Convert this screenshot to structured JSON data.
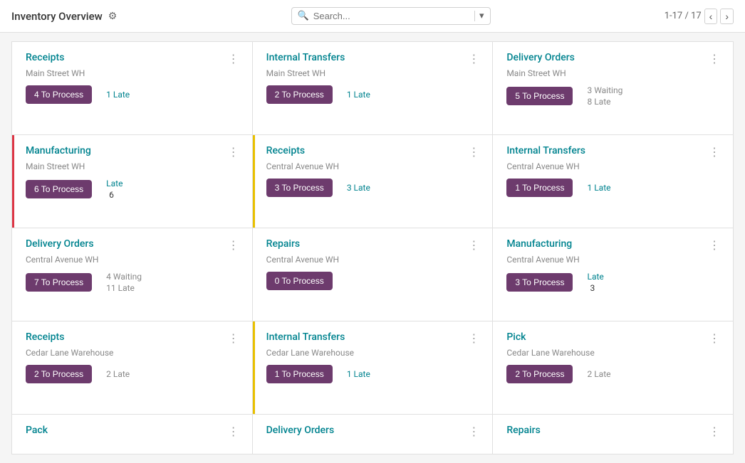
{
  "header": {
    "title": "Inventory Overview",
    "gear_label": "⚙",
    "search_placeholder": "Search...",
    "pagination": "1-17 / 17"
  },
  "cards": [
    {
      "id": "card-1",
      "title": "Receipts",
      "subtitle": "Main Street WH",
      "btn_label": "4 To Process",
      "stats": [
        {
          "label": "1 Late",
          "type": "late"
        }
      ],
      "border": "none"
    },
    {
      "id": "card-2",
      "title": "Internal Transfers",
      "subtitle": "Main Street WH",
      "btn_label": "2 To Process",
      "stats": [
        {
          "label": "1 Late",
          "type": "late"
        }
      ],
      "border": "none"
    },
    {
      "id": "card-3",
      "title": "Delivery Orders",
      "subtitle": "Main Street WH",
      "btn_label": "5 To Process",
      "stats": [
        {
          "label": "3 Waiting",
          "type": "waiting"
        },
        {
          "label": "8 Late",
          "type": "waiting"
        }
      ],
      "border": "none"
    },
    {
      "id": "card-4",
      "title": "Manufacturing",
      "subtitle": "Main Street WH",
      "btn_label": "6 To Process",
      "stats": [
        {
          "label": "Late",
          "type": "late"
        },
        {
          "label": "6",
          "type": "number"
        }
      ],
      "border": "red"
    },
    {
      "id": "card-5",
      "title": "Receipts",
      "subtitle": "Central Avenue WH",
      "btn_label": "3 To Process",
      "stats": [
        {
          "label": "3 Late",
          "type": "late"
        }
      ],
      "border": "yellow"
    },
    {
      "id": "card-6",
      "title": "Internal Transfers",
      "subtitle": "Central Avenue WH",
      "btn_label": "1 To Process",
      "stats": [
        {
          "label": "1 Late",
          "type": "late"
        }
      ],
      "border": "none"
    },
    {
      "id": "card-7",
      "title": "Delivery Orders",
      "subtitle": "Central Avenue WH",
      "btn_label": "7 To Process",
      "stats": [
        {
          "label": "4 Waiting",
          "type": "waiting"
        },
        {
          "label": "11 Late",
          "type": "waiting"
        }
      ],
      "border": "none"
    },
    {
      "id": "card-8",
      "title": "Repairs",
      "subtitle": "Central Avenue WH",
      "btn_label": "0 To Process",
      "stats": [],
      "border": "none"
    },
    {
      "id": "card-9",
      "title": "Manufacturing",
      "subtitle": "Central Avenue WH",
      "btn_label": "3 To Process",
      "stats": [
        {
          "label": "Late",
          "type": "late"
        },
        {
          "label": "3",
          "type": "number"
        }
      ],
      "border": "none"
    },
    {
      "id": "card-10",
      "title": "Receipts",
      "subtitle": "Cedar Lane Warehouse",
      "btn_label": "2 To Process",
      "stats": [
        {
          "label": "2 Late",
          "type": "waiting"
        }
      ],
      "border": "none"
    },
    {
      "id": "card-11",
      "title": "Internal Transfers",
      "subtitle": "Cedar Lane Warehouse",
      "btn_label": "1 To Process",
      "stats": [
        {
          "label": "1 Late",
          "type": "late"
        }
      ],
      "border": "yellow"
    },
    {
      "id": "card-12",
      "title": "Pick",
      "subtitle": "Cedar Lane Warehouse",
      "btn_label": "2 To Process",
      "stats": [
        {
          "label": "2 Late",
          "type": "waiting"
        }
      ],
      "border": "none"
    },
    {
      "id": "card-13",
      "title": "Pack",
      "subtitle": "",
      "btn_label": "",
      "stats": [],
      "border": "none",
      "partial": true
    },
    {
      "id": "card-14",
      "title": "Delivery Orders",
      "subtitle": "",
      "btn_label": "",
      "stats": [],
      "border": "none",
      "partial": true
    },
    {
      "id": "card-15",
      "title": "Repairs",
      "subtitle": "",
      "btn_label": "",
      "stats": [],
      "border": "none",
      "partial": true
    }
  ]
}
